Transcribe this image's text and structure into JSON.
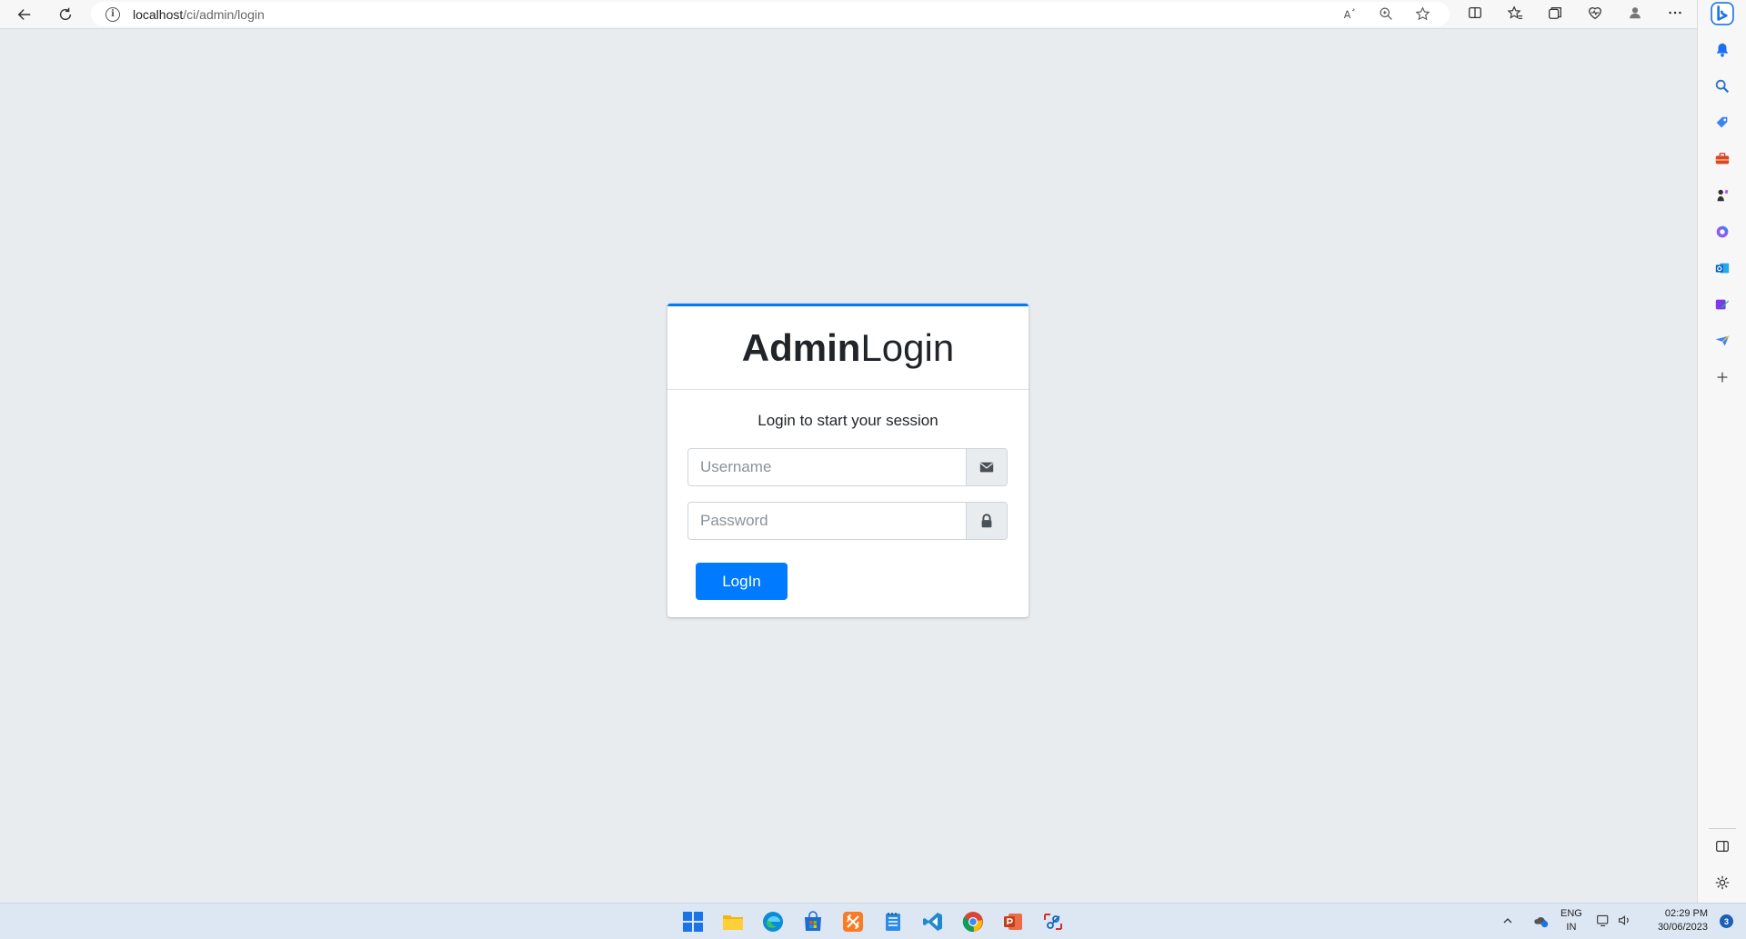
{
  "browser": {
    "url_host": "localhost",
    "url_path": "/ci/admin/login"
  },
  "login": {
    "title_bold": "Admin",
    "title_normal": "Login",
    "subtitle": "Login to start your session",
    "username_placeholder": "Username",
    "password_placeholder": "Password",
    "submit_label": "LogIn",
    "accent_color": "#007bff"
  },
  "taskbar": {
    "lang_line1": "ENG",
    "lang_line2": "IN",
    "time": "02:29 PM",
    "date": "30/06/2023",
    "notification_count": "3"
  },
  "icons": [
    "back-icon",
    "refresh-icon",
    "info-icon",
    "read-aloud-icon",
    "zoom-icon",
    "favorite-star-icon",
    "split-screen-icon",
    "favorites-icon",
    "collections-icon",
    "browser-essentials-icon",
    "profile-icon",
    "more-icon",
    "bing-icon",
    "bell-icon",
    "search-icon",
    "shopping-tag-icon",
    "tools-icon",
    "games-icon",
    "office-icon",
    "outlook-icon",
    "drop-icon",
    "send-icon",
    "add-icon",
    "sidebar-toggle-icon",
    "settings-icon",
    "envelope-icon",
    "lock-icon",
    "windows-start-icon",
    "file-explorer-icon",
    "edge-icon",
    "store-icon",
    "xampp-icon",
    "notepad-icon",
    "vscode-icon",
    "chrome-icon",
    "powerpoint-icon",
    "snipping-tool-icon"
  ]
}
